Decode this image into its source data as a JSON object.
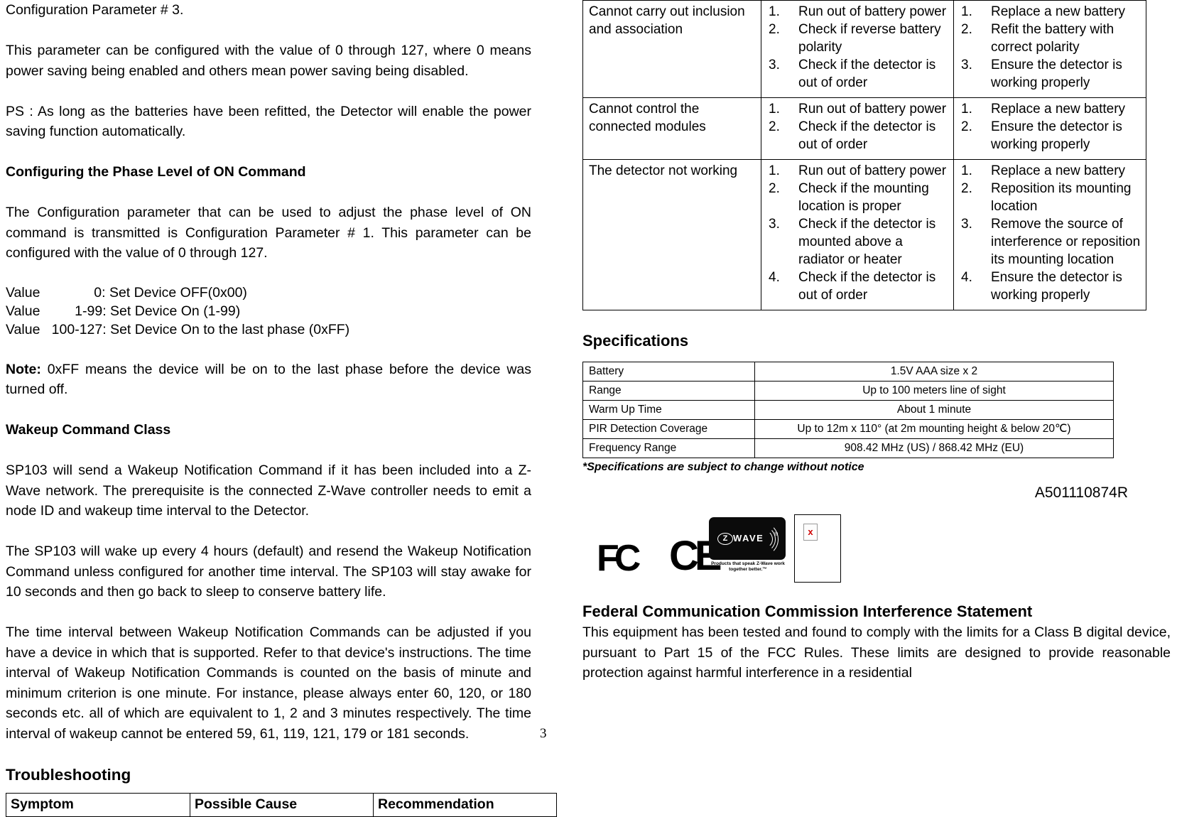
{
  "document": {
    "page_number": "3",
    "doc_code": "A501110874R"
  },
  "left_column": {
    "para_config_param": "Configuration Parameter # 3.",
    "para_value_range": "This parameter can be configured with the value of 0 through 127, where 0 means power saving being enabled and others mean power saving being disabled.",
    "para_ps": "PS : As long as the batteries have been refitted, the Detector will enable the power saving function automatically.",
    "heading_phase_level": "Configuring the Phase Level of ON Command",
    "para_phase_level": "The Configuration parameter that can be used to adjust the phase level of ON command is transmitted is Configuration Parameter # 1. This parameter can be configured with the value of 0 through 127.",
    "value_lines": [
      "Value              0: Set Device OFF(0x00)",
      "Value         1-99: Set Device On (1-99)",
      "Value   100-127: Set Device On to the last phase (0xFF)"
    ],
    "note_label": "Note:",
    "note_text": " 0xFF means the device will be on to the last phase before the device was turned off.",
    "heading_wakeup": "Wakeup Command Class",
    "para_wakeup_1": "SP103 will send a Wakeup Notification Command if it has been included into a Z-Wave network. The prerequisite is the connected Z-Wave controller needs to emit a node ID and wakeup time interval to the Detector.",
    "para_wakeup_2": "The SP103 will wake up every 4 hours (default) and resend the Wakeup Notification Command unless configured for another time interval. The SP103 will stay awake for 10 seconds and then go back to sleep to conserve battery life.",
    "para_wakeup_3": "The time interval between Wakeup Notification Commands can be adjusted if you have a device in which that is supported. Refer to that device's instructions.   The time interval of Wakeup Notification Commands is counted on the basis of minute and minimum criterion is one minute.   For instance, please always enter 60, 120, or 180 seconds etc. all of which are equivalent to 1, 2 and 3 minutes respectively. The time interval of wakeup cannot be entered 59, 61, 119, 121, 179 or 181 seconds.",
    "heading_troubleshooting": "Troubleshooting",
    "troubleshooting_headers": [
      "Symptom",
      "Possible Cause",
      "Recommendation"
    ]
  },
  "right_column": {
    "troubleshooting_rows": [
      {
        "symptom": "Cannot carry out inclusion and association",
        "causes": [
          "Run out of battery power",
          "Check if reverse battery polarity",
          "Check if the detector is out of order"
        ],
        "recommendations": [
          "Replace a new battery",
          "Refit the battery with correct polarity",
          "Ensure the detector is working properly"
        ]
      },
      {
        "symptom": "Cannot control the connected modules",
        "causes": [
          "Run out of battery power",
          "Check if the detector is out of order"
        ],
        "recommendations": [
          "Replace a new battery",
          "Ensure the detector is working properly"
        ]
      },
      {
        "symptom": "The detector not working",
        "causes": [
          "Run out of battery power",
          "Check if the mounting location is proper",
          "Check if the detector is mounted above a radiator or heater",
          "Check if the detector is out of order"
        ],
        "recommendations": [
          "Replace a new battery",
          "Reposition its mounting location",
          "Remove the source of interference or reposition its mounting location",
          "Ensure the detector is working properly"
        ]
      }
    ],
    "specifications_title": "Specifications",
    "specifications": [
      {
        "key": "Battery",
        "value": "1.5V AAA size x 2"
      },
      {
        "key": "Range",
        "value": "Up to 100 meters line of sight"
      },
      {
        "key": "Warm Up Time",
        "value": "About 1 minute"
      },
      {
        "key": "PIR Detection Coverage",
        "value": "Up to 12m x 110° (at 2m mounting height & below 20℃)"
      },
      {
        "key": "Frequency Range",
        "value": "908.42 MHz (US) / 868.42 MHz (EU)"
      }
    ],
    "specifications_note": "*Specifications are subject to change without notice",
    "logos": {
      "fcc_label": "FC",
      "ce_label": "CE",
      "zwave_z": "Z",
      "zwave_wave": "WAVE",
      "zwave_reg": "®",
      "zwave_tagline": "Products that speak Z-Wave work together better.™",
      "broken_image_mark": "x"
    },
    "fcc_heading": "Federal Communication Commission Interference Statement",
    "fcc_body": "This equipment has been tested and found to comply with the limits for a Class B digital device, pursuant to Part 15 of the FCC Rules.   These limits are designed to provide  reasonable  protection  against  harmful  interference  in  a  residential"
  }
}
